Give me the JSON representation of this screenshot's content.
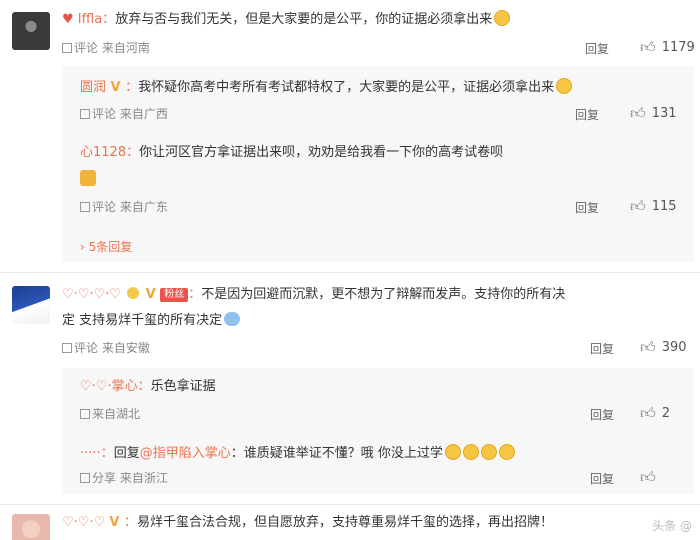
{
  "comments": [
    {
      "user": "Iffla",
      "text": "放弃与否与我们无关，但是大家要的是公平，你的证据必须拿出来",
      "meta": "评论  来自河南",
      "reply_label": "回复",
      "likes": "1179",
      "replies": [
        {
          "user": "圆润",
          "text": "我怀疑你高考中考所有考试都特权了，大家要的是公平，证据必须拿出来",
          "meta": "评论  来自广西",
          "reply_label": "回复",
          "likes": "131"
        },
        {
          "user": "心1128",
          "text": "你让河区官方拿证据出来呗，劝劝是给我看一下你的高考试卷呗",
          "meta": "评论  来自广东",
          "reply_label": "回复",
          "likes": "115"
        }
      ],
      "more_replies": "5条回复"
    },
    {
      "user": "",
      "badge": "粉丝",
      "text": "不是因为回避而沉默，更不想为了辩解而发声。支持你的所有决",
      "text2": "定 支持易烊千玺的所有决定",
      "meta": "评论  来自安徽",
      "reply_label": "回复",
      "likes": "390",
      "replies": [
        {
          "user": "掌心",
          "text": "乐色拿证据",
          "meta": "来自湖北",
          "reply_label": "回复",
          "likes": "2"
        },
        {
          "user": "",
          "text_prefix": "回复",
          "mention": "@指甲陷入掌心",
          "text": "谁质疑谁举证不懂？哦 你没上过学",
          "meta": "分享  来自浙江",
          "reply_label": "回复",
          "likes": ""
        }
      ]
    },
    {
      "user": "",
      "text": "易烊千玺合法合规，但自愿放弃，支持尊重易烊千玺的选择，再出招牌！",
      "watermark": "头条 @"
    }
  ]
}
